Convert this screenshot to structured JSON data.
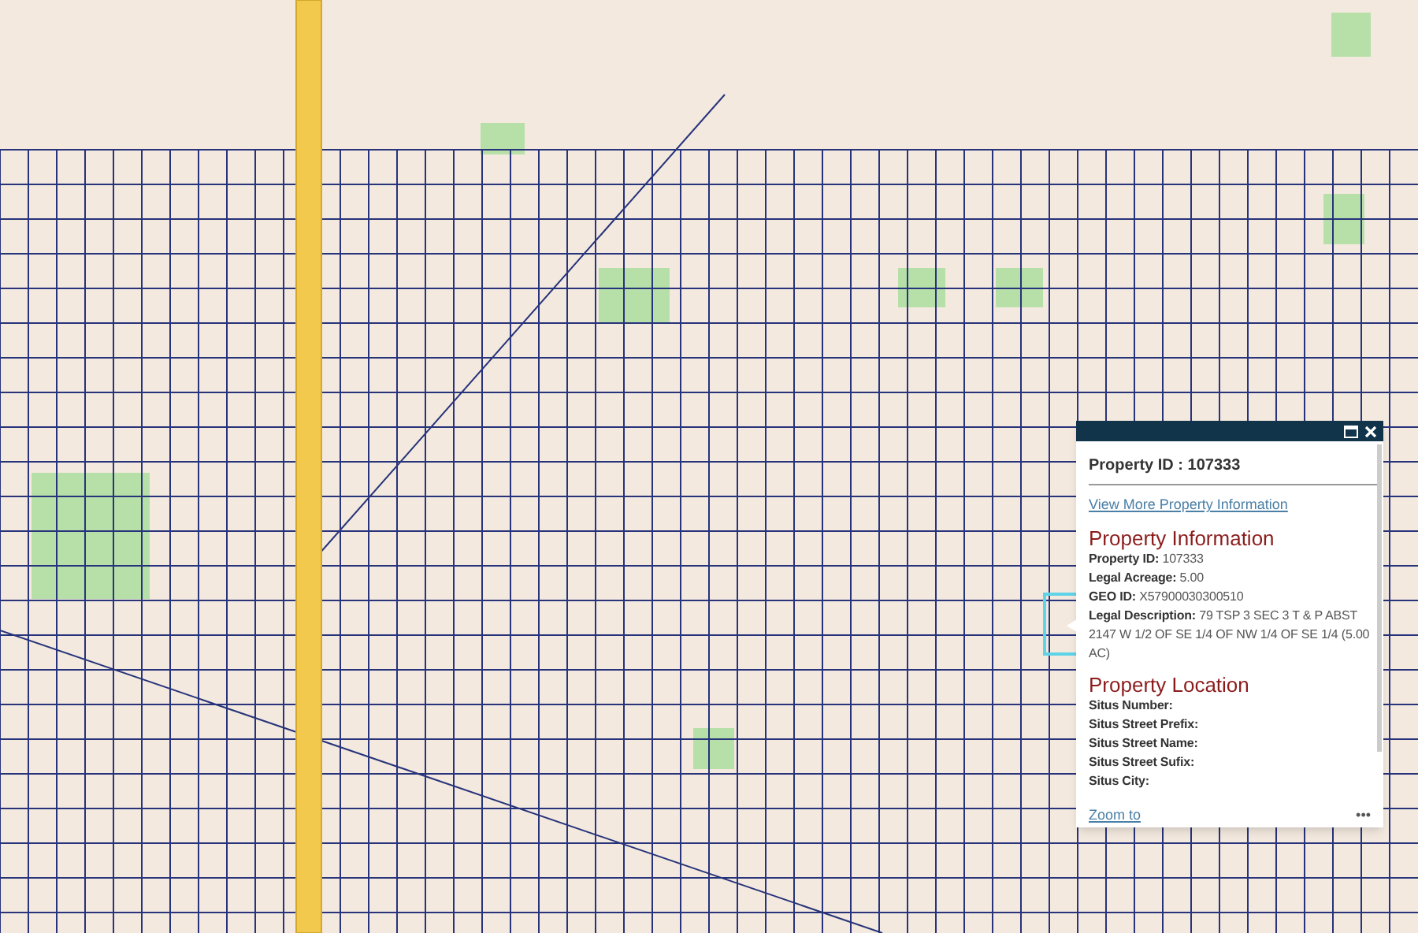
{
  "popup": {
    "title": "Property ID : 107333",
    "link": "View More Property Information",
    "sections": [
      {
        "heading": "Property Information",
        "fields": [
          {
            "label": "Property ID:",
            "value": "107333"
          },
          {
            "label": "Legal Acreage:",
            "value": "5.00"
          },
          {
            "label": "GEO ID:",
            "value": "X57900030300510"
          },
          {
            "label": "Legal Description:",
            "value": "79 TSP 3 SEC 3 T & P ABST 2147 W 1/2 OF SE 1/4 OF NW 1/4 OF SE 1/4 (5.00 AC)"
          }
        ]
      },
      {
        "heading": "Property Location",
        "fields": [
          {
            "label": "Situs Number:"
          },
          {
            "label": "Situs Street Prefix:"
          },
          {
            "label": "Situs Street Name:"
          },
          {
            "label": "Situs Street Sufix:"
          },
          {
            "label": "Situs City:"
          }
        ]
      }
    ],
    "footer_link": "Zoom to",
    "menu": "•••"
  }
}
